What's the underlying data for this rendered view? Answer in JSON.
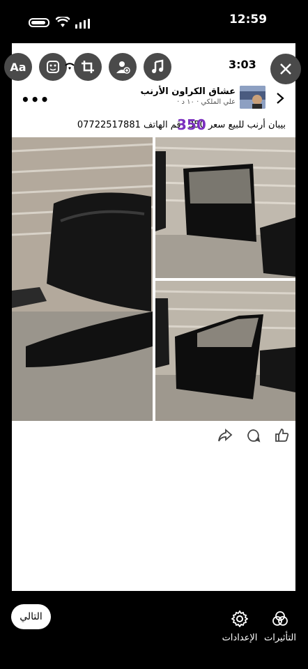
{
  "status_bar": {
    "time": "12:59"
  },
  "editor_tools": {
    "text_label": "Aa",
    "inner_time": "3:03"
  },
  "post": {
    "page_name": "عشاق الكراون الأرنب",
    "author_meta": "علي الملكي · ١٠ د ·",
    "caption": "بيبان أرنب  للبيع سعر 350 رقم الهاتف 07722517881",
    "price_overlay": "350"
  },
  "bottom": {
    "next_label": "التالي",
    "settings_label": "الإعدادات",
    "effects_label": "التأثيرات"
  },
  "colors": {
    "background": "#000000",
    "card": "#ffffff",
    "tool_circle": "#4a4a4a",
    "price": "#7b2fbf"
  }
}
